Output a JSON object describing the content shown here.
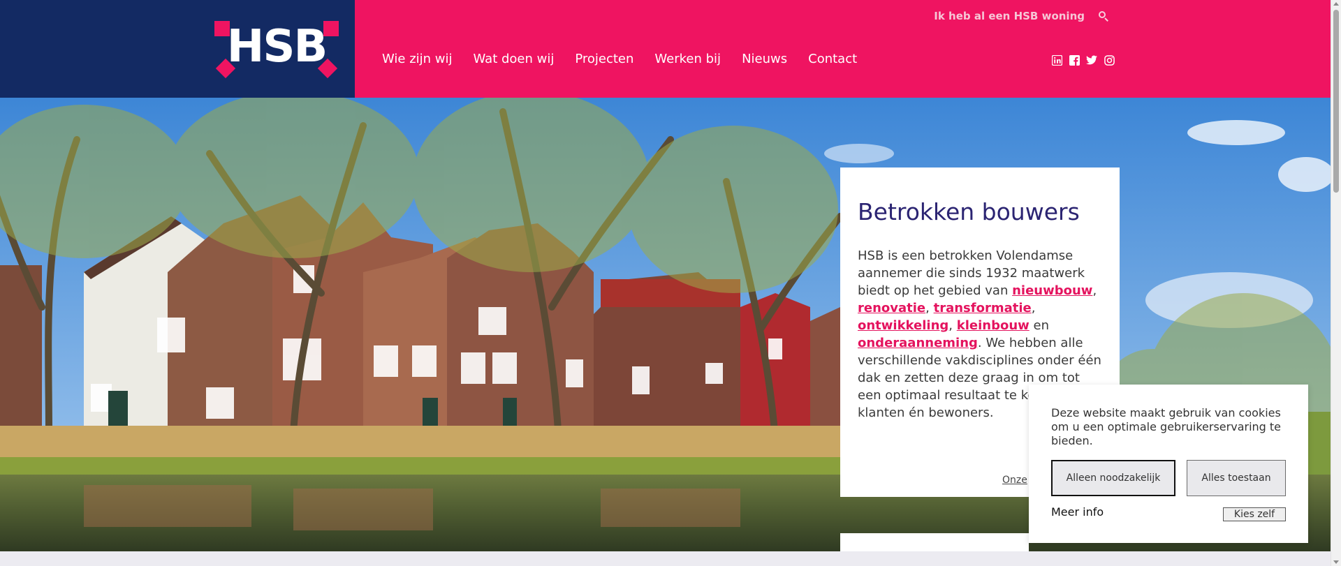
{
  "header": {
    "logo_text": "HSB",
    "topbar_link": "Ik heb al een HSB woning",
    "nav": [
      "Wie zijn wij",
      "Wat doen wij",
      "Projecten",
      "Werken bij",
      "Nieuws",
      "Contact"
    ],
    "socials": [
      "linkedin-icon",
      "facebook-icon",
      "twitter-icon",
      "instagram-icon"
    ],
    "colors": {
      "brand_pink": "#ef1461",
      "brand_navy": "#132a63"
    }
  },
  "card": {
    "title": "Betrokken bouwers",
    "text_1": "HSB is een betrokken Volendamse aannemer die sinds 1932 maatwerk biedt op het gebied van ",
    "hl_1": "nieuwbouw",
    "sep_1": ", ",
    "hl_2": "renovatie",
    "sep_2": ", ",
    "hl_3": "transformatie",
    "sep_3": ", ",
    "hl_4": "ontwikkeling",
    "sep_4": ", ",
    "hl_5": "kleinbouw",
    "sep_5": " en ",
    "hl_6": "onderaanneming",
    "text_2": ". We hebben alle verschillende vakdisciplines onder één dak en zetten deze graag in om tot een optimaal resultaat te komen voor klanten én bewoners.",
    "more_link": "Onze"
  },
  "cookie": {
    "message": "Deze website maakt gebruik van cookies om u een optimale gebruikerservaring te bieden.",
    "btn_necessary": "Alleen noodzakelijk",
    "btn_all": "Alles toestaan",
    "more_info": "Meer info",
    "choose": "Kies zelf"
  }
}
